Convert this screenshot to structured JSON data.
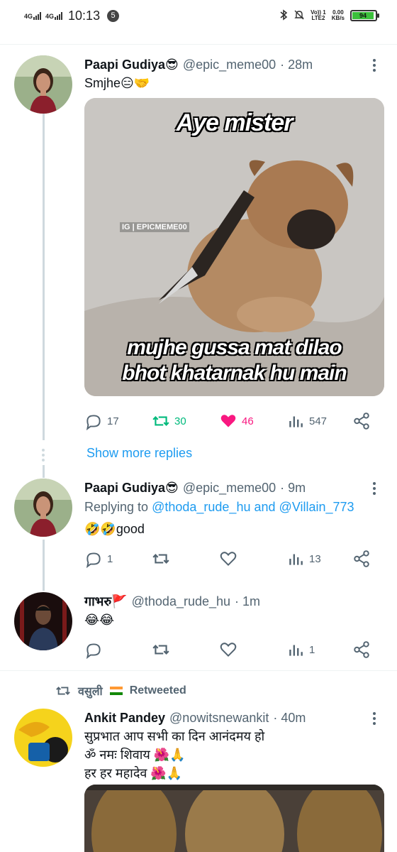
{
  "status_bar": {
    "net1": "4G",
    "net2": "4G",
    "time": "10:13",
    "notif_count": "5",
    "volte_line1": "Vo)) 1",
    "volte_line2": "LTE2",
    "speed_value": "0.00",
    "speed_unit": "KB/s",
    "battery": "94",
    "battery_level": 0.94
  },
  "tweets": [
    {
      "name": "Paapi Gudiya😎",
      "handle": "@epic_meme00",
      "time": "· 28m",
      "text": "Smjhe😑🤝",
      "media": {
        "top_text": "Aye mister",
        "watermark": "IG | EPICMEME00",
        "bottom_line1": "mujhe gussa mat dilao",
        "bottom_line2": "bhot khatarnak hu main"
      },
      "replies": "17",
      "retweets": "30",
      "likes": "46",
      "views": "547"
    },
    {
      "name": "Paapi Gudiya😎",
      "handle": "@epic_meme00",
      "time": "· 9m",
      "replying_label": "Replying to",
      "mention1": "@thoda_rude_hu",
      "and_label": "and",
      "mention2": "@Villain_773",
      "text": "🤣🤣good",
      "replies": "1",
      "retweets": "",
      "likes": "",
      "views": "13"
    },
    {
      "name": "गाभरु🚩",
      "handle": "@thoda_rude_hu",
      "time": "· 1m",
      "text": "😂😂",
      "replies": "",
      "retweets": "",
      "likes": "",
      "views": "1"
    },
    {
      "name": "Ankit Pandey",
      "handle": "@nowitsnewankit",
      "time": "· 40m",
      "line1": "सुप्रभात आप सभी का दिन आनंदमय हो",
      "line2": "ॐ नमः शिवाय 🌺🙏",
      "line3": "हर हर महादेव 🌺🙏"
    }
  ],
  "show_more": "Show more replies",
  "retweeted": {
    "user": "वसुली",
    "label": "Retweeted"
  },
  "colors": {
    "accent": "#1d9bf0",
    "retweet": "#00ba7c",
    "like": "#f91880",
    "secondary_text": "#536471"
  }
}
